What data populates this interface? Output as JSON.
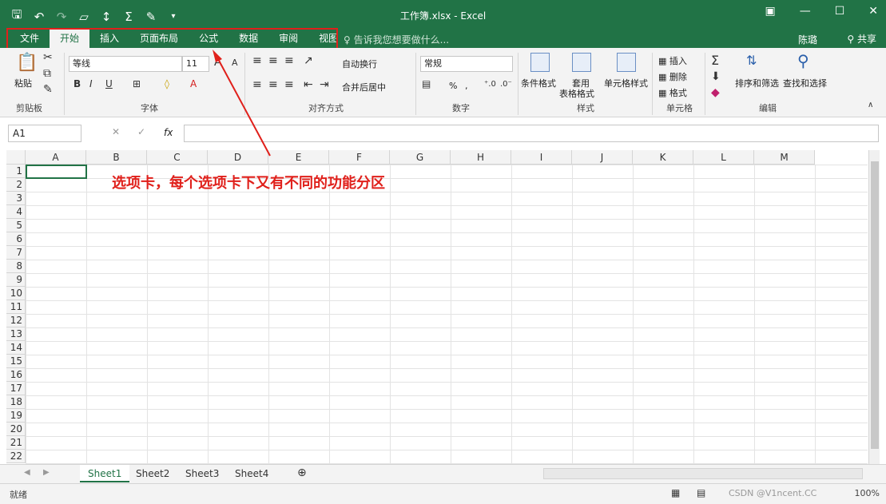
{
  "window": {
    "title": "工作簿.xlsx - Excel"
  },
  "qat": {
    "save_icon": "save-icon",
    "undo_icon": "undo-icon",
    "redo_icon": "redo-icon",
    "open_icon": "open-icon",
    "sort_icon": "sort-icon",
    "sum_icon": "sum-icon",
    "brush_icon": "brush-icon"
  },
  "tabs": [
    "文件",
    "开始",
    "插入",
    "页面布局",
    "公式",
    "数据",
    "审阅",
    "视图"
  ],
  "active_tab": "开始",
  "tell_me": "告诉我您想要做什么...",
  "user": "陈璐",
  "share": "共享",
  "ribbon": {
    "clipboard": {
      "paste": "粘贴",
      "label": "剪贴板"
    },
    "font": {
      "name": "等线",
      "size": "11",
      "label": "字体"
    },
    "alignment": {
      "wrap": "自动换行",
      "merge": "合并后居中",
      "label": "对齐方式"
    },
    "number": {
      "format": "常规",
      "percent": "%",
      "comma": ",",
      "label": "数字"
    },
    "styles": {
      "conditional": "条件格式",
      "table": "套用",
      "table2": "表格格式",
      "cell": "单元格样式",
      "label": "样式"
    },
    "cells": {
      "insert": "插入",
      "delete": "删除",
      "format": "格式",
      "label": "单元格"
    },
    "editing": {
      "sort": "排序和筛选",
      "find": "查找和选择",
      "label": "编辑"
    }
  },
  "formula_bar": {
    "name_box": "A1",
    "fx": "fx",
    "value": ""
  },
  "columns": [
    "A",
    "B",
    "C",
    "D",
    "E",
    "F",
    "G",
    "H",
    "I",
    "J",
    "K",
    "L",
    "M"
  ],
  "rows": [
    "1",
    "2",
    "3",
    "4",
    "5",
    "6",
    "7",
    "8",
    "9",
    "10",
    "11",
    "12",
    "13",
    "14",
    "15",
    "16",
    "17",
    "18",
    "19",
    "20",
    "21",
    "22"
  ],
  "annotation": "选项卡，每个选项卡下又有不同的功能分区",
  "sheets": [
    "Sheet1",
    "Sheet2",
    "Sheet3",
    "Sheet4"
  ],
  "active_sheet": "Sheet1",
  "status": {
    "ready": "就绪",
    "zoom": "100%",
    "watermark": "CSDN @V1ncent.CC"
  },
  "colors": {
    "brand": "#217346",
    "annotation": "#e0201b"
  }
}
